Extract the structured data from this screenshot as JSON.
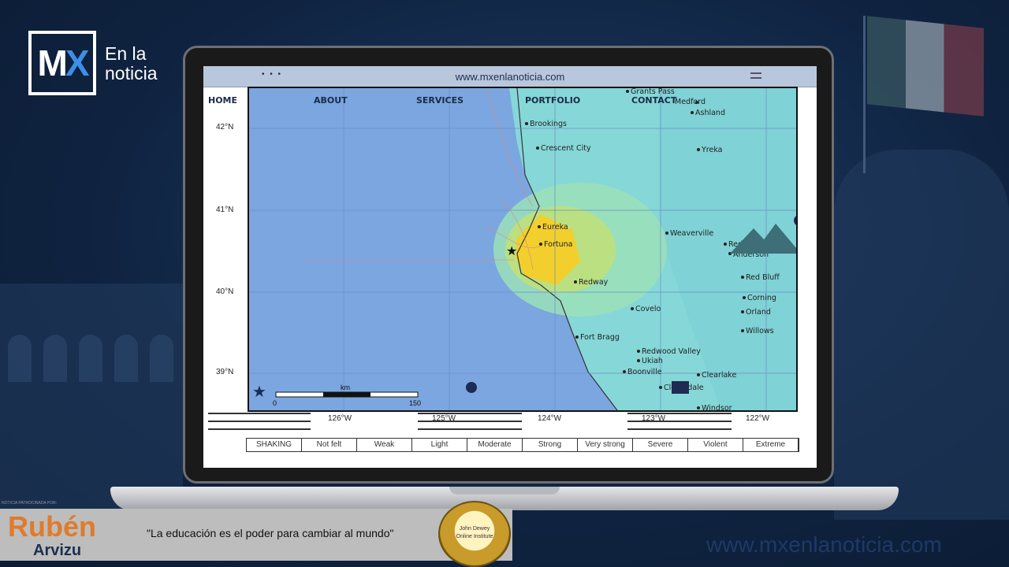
{
  "logo": {
    "mark": "MX",
    "line1": "En la",
    "line2": "noticia"
  },
  "browser": {
    "url": "www.mxenlanoticia.com",
    "dots": "• • •"
  },
  "nav": {
    "home": "HOME",
    "about": "ABOUT",
    "services": "SERVICES",
    "portfolio": "PORTFOLIO",
    "contact": "CONTACT"
  },
  "map": {
    "latitudes": [
      "42°N",
      "41°N",
      "40°N",
      "39°N"
    ],
    "longitudes": [
      "126°W",
      "125°W",
      "124°W",
      "123°W",
      "122°W"
    ],
    "scale_unit": "km",
    "scale_min": "0",
    "scale_max": "150",
    "places": [
      "Grants Pass",
      "Medford",
      "Ashland",
      "Brookings",
      "Crescent City",
      "Yreka",
      "Eureka",
      "Fortuna",
      "Weaverville",
      "Redding",
      "Anderson",
      "Red Bluff",
      "Redway",
      "Covelo",
      "Corning",
      "Orland",
      "Willows",
      "Fort Bragg",
      "Redwood Valley",
      "Ukiah",
      "Boonville",
      "Clearlake",
      "Cloverdale",
      "Windsor"
    ]
  },
  "legend": {
    "label": "SHAKING",
    "items": [
      "Not felt",
      "Weak",
      "Light",
      "Moderate",
      "Strong",
      "Very strong",
      "Severe",
      "Violent",
      "Extreme"
    ]
  },
  "footer": {
    "sponsor": "NOTICIA PATROCINADA POR:",
    "name_first": "Rubén",
    "name_last": "Arvizu",
    "quote": "\"La educación es el poder para cambiar al mundo\"",
    "seal_line1": "John Dewey",
    "seal_line2": "Online Institute",
    "url": "www.mxenlanoticia.com"
  }
}
